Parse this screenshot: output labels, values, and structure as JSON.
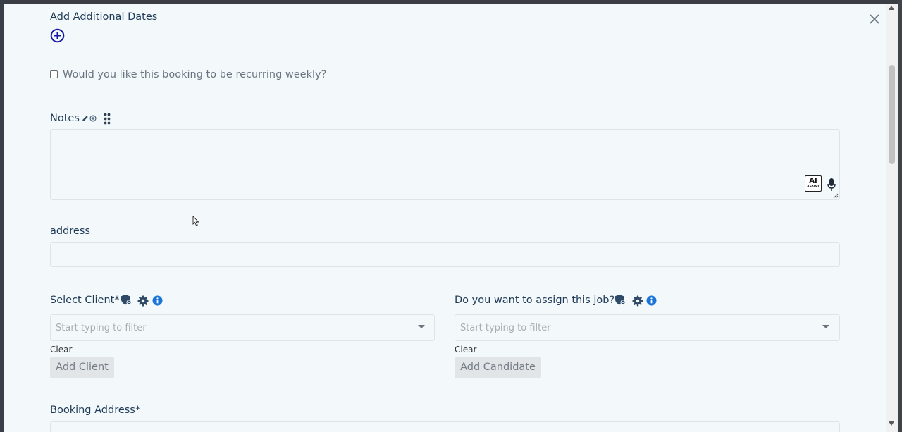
{
  "modal": {
    "add_dates_label": "Add Additional Dates",
    "recurring_label": "Would you like this booking to be recurring weekly?",
    "notes_label": "Notes",
    "ai_assist": {
      "main": "AI",
      "sub": "ASSIST"
    },
    "address_label": "address",
    "select_client": {
      "label": "Select Client*",
      "placeholder": "Start typing to filter",
      "clear": "Clear",
      "add_button": "Add Client"
    },
    "assign_job": {
      "label": "Do you want to assign this job?",
      "placeholder": "Start typing to filter",
      "clear": "Clear",
      "add_button": "Add Candidate"
    },
    "booking_address_label": "Booking Address*"
  },
  "colors": {
    "modal_bg": "#f3f9fb",
    "text": "#1f3a57",
    "accent_blue": "#1a73d9",
    "plus_icon": "#1a1aa0"
  },
  "icons": [
    "close-icon",
    "plus-circle-icon",
    "pencil-icon",
    "plus-small-icon",
    "drag-handle-icon",
    "ai-assist-icon",
    "microphone-icon",
    "shield-lock-icon",
    "gear-icon",
    "info-icon",
    "chevron-down-icon"
  ]
}
